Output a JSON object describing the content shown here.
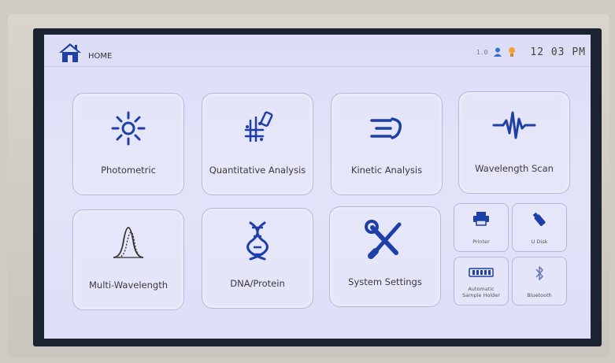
{
  "topbar": {
    "home_label": "HOME",
    "usb_indicator": "1.0",
    "time": "12 03 PM"
  },
  "tiles": {
    "photometric": "Photometric",
    "quantitative": "Quantitative Analysis",
    "kinetic": "Kinetic Analysis",
    "wavelength_scan": "Wavelength Scan",
    "multi_wavelength": "Multi-Wavelength",
    "dna_protein": "DNA/Protein",
    "system_settings": "System Settings"
  },
  "small_tiles": {
    "printer": "Printer",
    "u_disk": "U Disk",
    "sample_holder_line1": "Automatic",
    "sample_holder_line2": "Sample Holder",
    "bluetooth": "Bluetooth"
  },
  "colors": {
    "icon_blue": "#1f3fa8",
    "screen_bg": "#dfdff7",
    "tile_border": "#b7b7dd"
  }
}
